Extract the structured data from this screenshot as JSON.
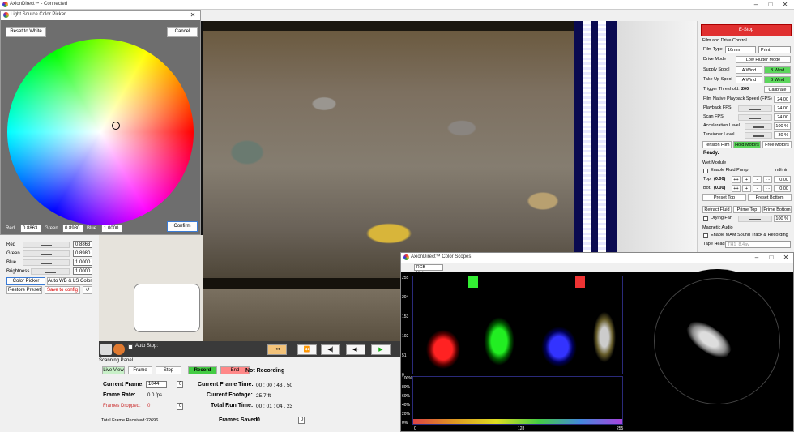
{
  "main": {
    "title": "AxionDirect™ - Connected"
  },
  "picker": {
    "title": "Light Source Color Picker",
    "reset_label": "Reset to White",
    "cancel_label": "Cancel",
    "confirm_label": "Confirm",
    "red_label": "Red",
    "red_value": "0.8863",
    "green_label": "Green",
    "green_value": "0.8980",
    "blue_label": "Blue",
    "blue_value": "1.0000"
  },
  "left_panel": {
    "red_label": "Red",
    "red_value": "0.8863",
    "green_label": "Green",
    "green_value": "0.8980",
    "blue_label": "Blue",
    "blue_value": "1.0000",
    "brightness_label": "Brightness",
    "brightness_value": "1.0000",
    "color_picker_label": "Color Picker",
    "auto_wb_label": "Auto WB & LS Color",
    "restore_label": "Restore Preset",
    "save_label": "Save to config"
  },
  "scan": {
    "auto_stop_label": "Auto Stop:",
    "panel_label": "Scanning Panel",
    "live_view": "Live View",
    "frame": "Frame",
    "stop": "Stop",
    "record": "Record",
    "end": "End",
    "not_recording": "Not Recording",
    "current_frame_label": "Current Frame:",
    "current_frame": "1044",
    "frame_rate_label": "Frame Rate:",
    "frame_rate": "0.0 fps",
    "frames_dropped_label": "Frames Dropped:",
    "frames_dropped": "0",
    "frames_dropped_zero": "0",
    "current_frame_time_label": "Current Frame Time:",
    "current_frame_time": "00 : 00 : 43 . 50",
    "current_footage_label": "Current Footage:",
    "current_footage": "25.7 ft",
    "total_run_time_label": "Total Run Time:",
    "total_run_time": "00 : 01 : 04 . 23",
    "total_received_label": "Total Frame Received:",
    "total_received": "32696",
    "frames_saved_label": "Frames Saved:",
    "frames_saved": "0",
    "frames_saved_zero": "0",
    "field_zero": "0"
  },
  "right": {
    "estop": "E-Stop",
    "film_drive": "Film and Drive Control",
    "film_type_label": "Film Type",
    "film_type": "16mm",
    "film_stock": "Print",
    "drive_mode_label": "Drive Mode",
    "drive_mode": "Low Flutter Mode",
    "supply_label": "Supply Spool",
    "a_wind": "A Wind",
    "b_wind": "B Wind",
    "takeup_label": "Take Up Spool",
    "trigger_label": "Trigger Threshold:",
    "trigger_value": "200",
    "calibrate": "Calibrate",
    "native_label": "Film Native Playback Speed (FPS)",
    "native_value": "24.00",
    "playback_label": "Playback FPS",
    "playback_value": "24.00",
    "scan_fps_label": "Scan FPS",
    "scan_fps_value": "24.00",
    "accel_label": "Acceleration Level",
    "accel_value": "100 %",
    "tension_label": "Tensioner Level",
    "tension_value": "30 %",
    "tension_film": "Tension Film",
    "hold_motors": "Hold Motors",
    "free_motors": "Free Motors",
    "ready": "Ready.",
    "wet_module": "Wet Module",
    "enable_pump": "Enable Fluid Pump",
    "ml_min": "ml/min",
    "top_label": "Top",
    "top_val": "(0.00)",
    "bot_label": "Bot.",
    "bot_val": "(0.00)",
    "pp": "++",
    "p": "+",
    "m": "-",
    "mm": "- -",
    "zero": "0.00",
    "preset_top": "Preset Top",
    "preset_bottom": "Preset Bottom",
    "retract": "Retract Fluid",
    "prime_top": "Prime Top",
    "prime_bottom": "Prime Bottom",
    "drying_fan": "Drying Fan",
    "fan_value": "100 %",
    "mag_audio": "Magnetic Audio",
    "enable_mag": "Enable MAM Sound Track & Recording",
    "tape_head_label": "Tape Head",
    "tape_head": "TH1_8.4ay"
  },
  "scopes": {
    "title": "AxionDirect™ Color Scopes",
    "mode": "RGB Histogram",
    "y_labels": [
      "255",
      "204",
      "153",
      "102",
      "51",
      "0"
    ],
    "pct_labels": [
      "100%",
      "80%",
      "60%",
      "40%",
      "20%",
      "0%"
    ],
    "x_labels": [
      "0",
      "128",
      "255"
    ]
  }
}
